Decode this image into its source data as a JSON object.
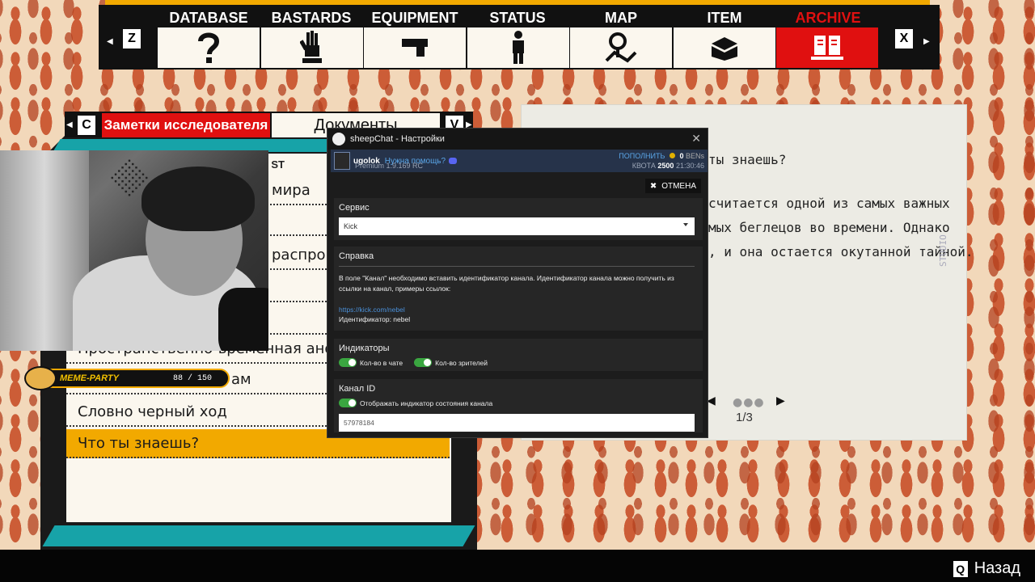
{
  "nav": {
    "left_key": "Z",
    "right_key": "X",
    "tabs": [
      {
        "label": "DATABASE",
        "icon": "question-icon"
      },
      {
        "label": "BASTARDS",
        "icon": "zombie-hand-icon"
      },
      {
        "label": "EQUIPMENT",
        "icon": "gun-icon"
      },
      {
        "label": "STATUS",
        "icon": "person-icon"
      },
      {
        "label": "MAP",
        "icon": "map-pin-icon"
      },
      {
        "label": "ITEM",
        "icon": "box-icon"
      },
      {
        "label": "ARCHIVE",
        "icon": "book-icon"
      }
    ]
  },
  "left_panel": {
    "left_key": "C",
    "right_key": "V",
    "tab_active": "Заметки исследователя",
    "tab_inactive": "Документы",
    "header_fragment": "ST",
    "items": [
      "мира",
      "распро",
      "Пространственно-временная аномалия",
      "ам",
      "Словно черный ход",
      "Что ты знаешь?"
    ]
  },
  "meme_party": {
    "name": "MEME-PARTY",
    "count": "88 / 150"
  },
  "paper": {
    "lines": [
      "ты знаешь?",
      "считается одной из самых важных",
      "мых беглецов во времени. Однако",
      ", и она остается окутанной тайной."
    ],
    "page": "1/3",
    "stamp": "STUDIO"
  },
  "dialog": {
    "title": "sheepChat - Настройки",
    "user": {
      "name": "ugolok",
      "help": "Нужна помощь?",
      "plan": "Premium 1.9.169 RC",
      "topup": "ПОПОЛНИТЬ",
      "balance": "0",
      "currency": "BENs",
      "quota_label": "КВОТА",
      "quota": "2500",
      "time": "21:30:46"
    },
    "cancel": "ОТМЕНА",
    "service": {
      "title": "Сервис",
      "value": "Kick"
    },
    "help_section": {
      "title": "Справка",
      "text": "В поле \"Канал\" необходимо вставить идентификатор канала. Идентификатор канала можно получить из ссылки на канал, примеры ссылок:",
      "url": "https://kick.com/nebel",
      "id_line": "Идентификатор: nebel"
    },
    "indicators": {
      "title": "Индикаторы",
      "chat": "Кол-во в чате",
      "viewers": "Кол-во зрителей"
    },
    "channel": {
      "title": "Канал ID",
      "toggle": "Отображать индикатор состояния канала",
      "value": "57978184"
    }
  },
  "footer": {
    "back_key": "Q",
    "back_label": "Назад"
  }
}
